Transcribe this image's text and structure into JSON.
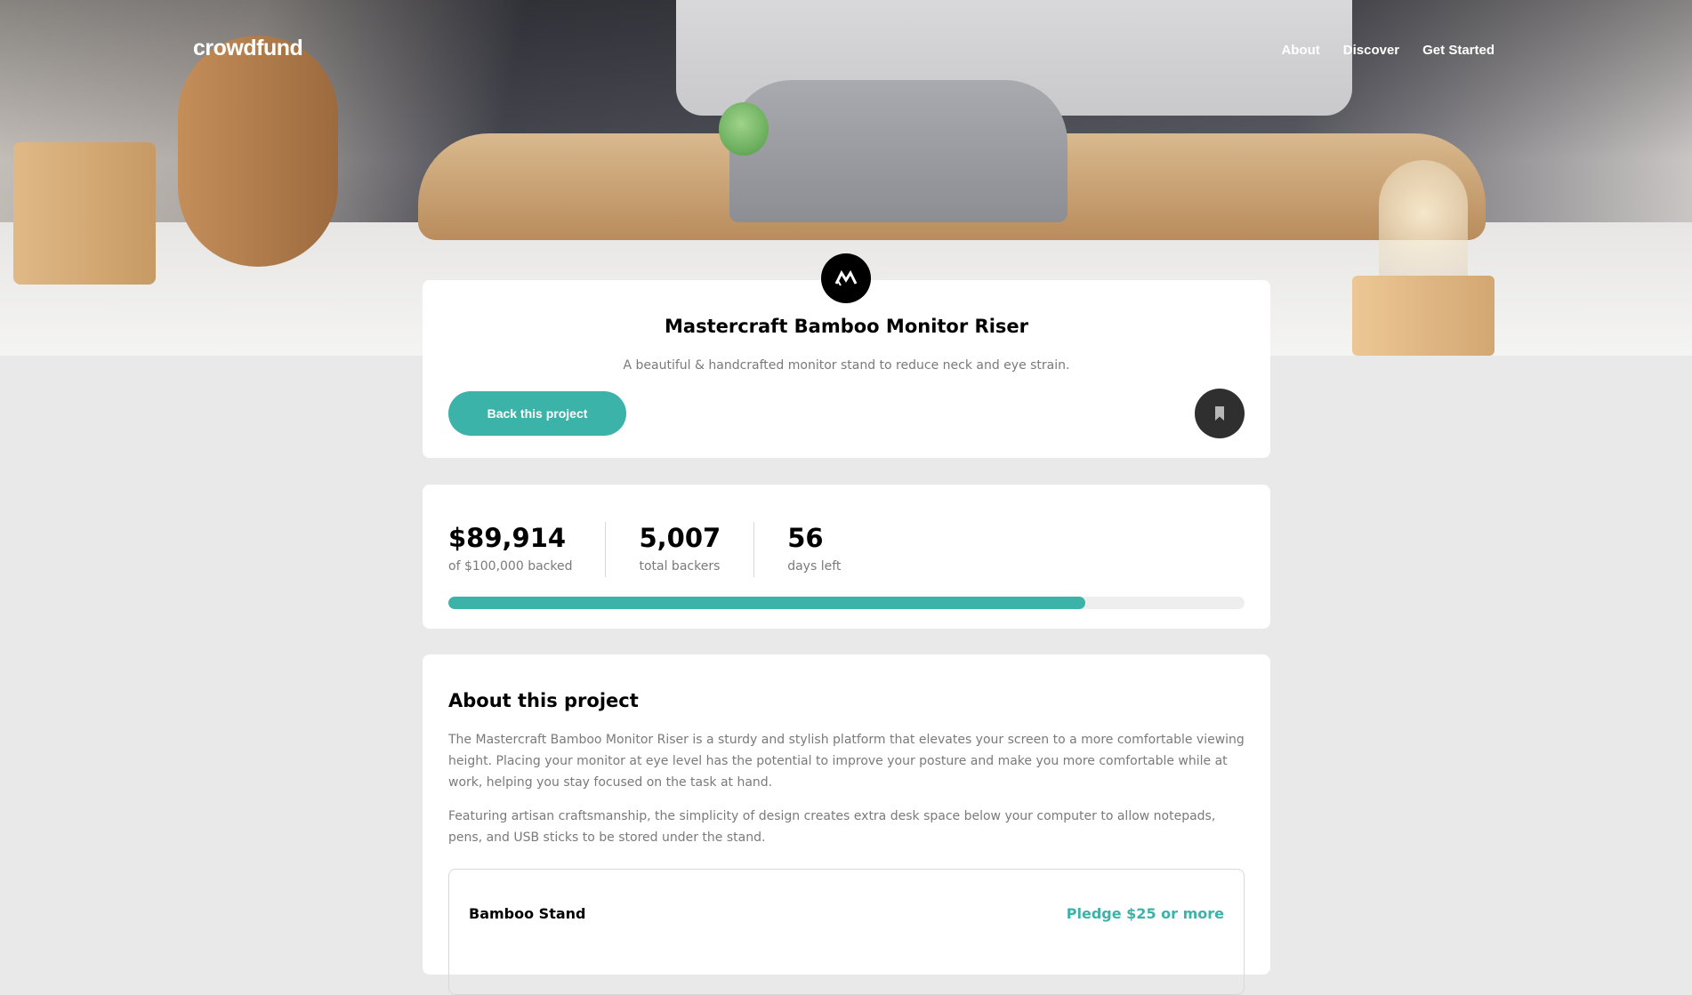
{
  "brand": {
    "logo": "crowdfund"
  },
  "nav": {
    "items": [
      "About",
      "Discover",
      "Get Started"
    ]
  },
  "project": {
    "title": "Mastercraft Bamboo Monitor Riser",
    "description": "A beautiful & handcrafted monitor stand to reduce neck and eye strain.",
    "back_label": "Back this project"
  },
  "stats": {
    "backed": "$89,914",
    "backed_label": "of $100,000 backed",
    "backers": "5,007",
    "backers_label": "total backers",
    "days": "56",
    "days_label": "days left",
    "progress_fraction": 0.8
  },
  "about": {
    "title": "About this project",
    "p1": "The Mastercraft Bamboo Monitor Riser is a sturdy and stylish platform that elevates your screen to a more comfortable viewing height. Placing your monitor at eye level has the potential to improve your posture and make you more comfortable while at work, helping you stay focused on the task at hand.",
    "p2": "Featuring artisan craftsmanship, the simplicity of design creates extra desk space below your computer to allow notepads, pens, and USB sticks to be stored under the stand."
  },
  "rewards": [
    {
      "name": "Bamboo Stand",
      "pledge": "Pledge $25 or more"
    }
  ],
  "colors": {
    "accent": "#3cb3a8",
    "dark": "#2f2f2f",
    "muted": "#7a7a7a",
    "background": "#e9e9e9"
  }
}
